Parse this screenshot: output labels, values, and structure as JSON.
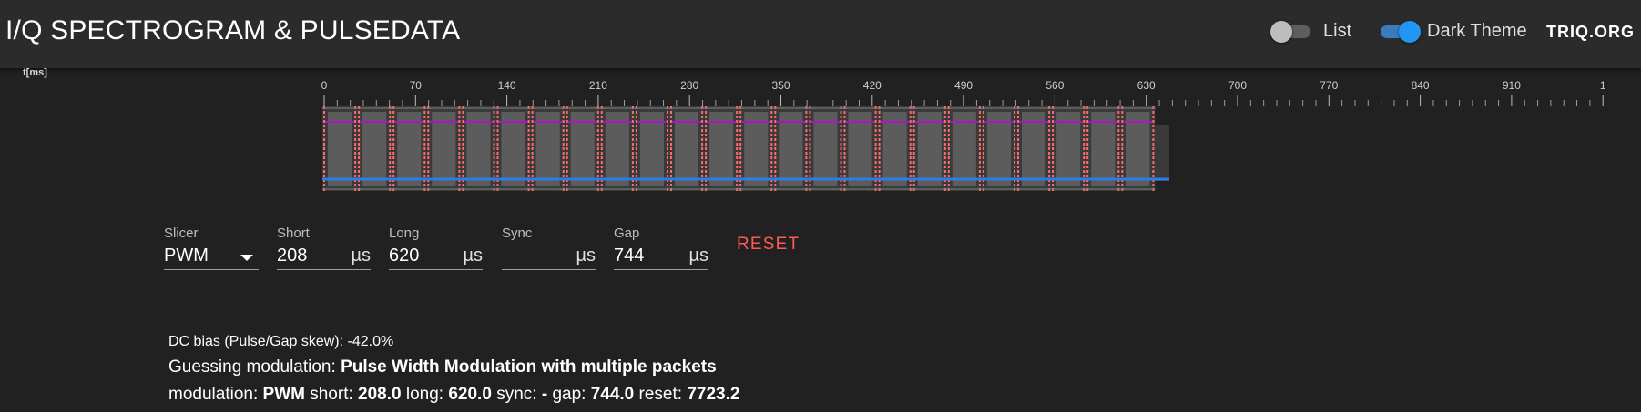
{
  "header": {
    "title": "I/Q SPECTROGRAM & PULSEDATA",
    "list_label": "List",
    "list_on": false,
    "dark_label": "Dark Theme",
    "dark_on": true,
    "brand": "TRIQ.ORG"
  },
  "axis": {
    "unit_label": "t[ms]",
    "ticks": [
      "0",
      "70",
      "140",
      "210",
      "280",
      "350",
      "420",
      "490",
      "560",
      "630",
      "700",
      "770",
      "840",
      "910",
      "1"
    ]
  },
  "spectrogram": {
    "packet_count": 24,
    "colors": {
      "background": "#212121",
      "cell": "#5c5c5c",
      "pulse_edge": "#ff6b6b",
      "purple_line": "#b012c8",
      "blue_line": "#2f7de1"
    }
  },
  "controls": {
    "slicer": {
      "label": "Slicer",
      "value": "PWM"
    },
    "short": {
      "label": "Short",
      "value": "208",
      "unit": "µs"
    },
    "long": {
      "label": "Long",
      "value": "620",
      "unit": "µs"
    },
    "sync": {
      "label": "Sync",
      "value": "",
      "unit": "µs"
    },
    "gap": {
      "label": "Gap",
      "value": "744",
      "unit": "µs"
    },
    "reset_label": "RESET"
  },
  "analysis": {
    "dc_bias_label": "DC bias (Pulse/Gap skew):",
    "dc_bias_value": "-42.0%",
    "guess_label": "Guessing modulation:",
    "guess_value": "Pulse Width Modulation with multiple packets",
    "mod_label": "modulation:",
    "mod_value": "PWM",
    "short_label": "short:",
    "short_value": "208.0",
    "long_label": "long:",
    "long_value": "620.0",
    "sync_label": "sync:",
    "sync_value": "-",
    "gap_label": "gap:",
    "gap_value": "744.0",
    "reset_label": "reset:",
    "reset_value": "7723.2"
  }
}
